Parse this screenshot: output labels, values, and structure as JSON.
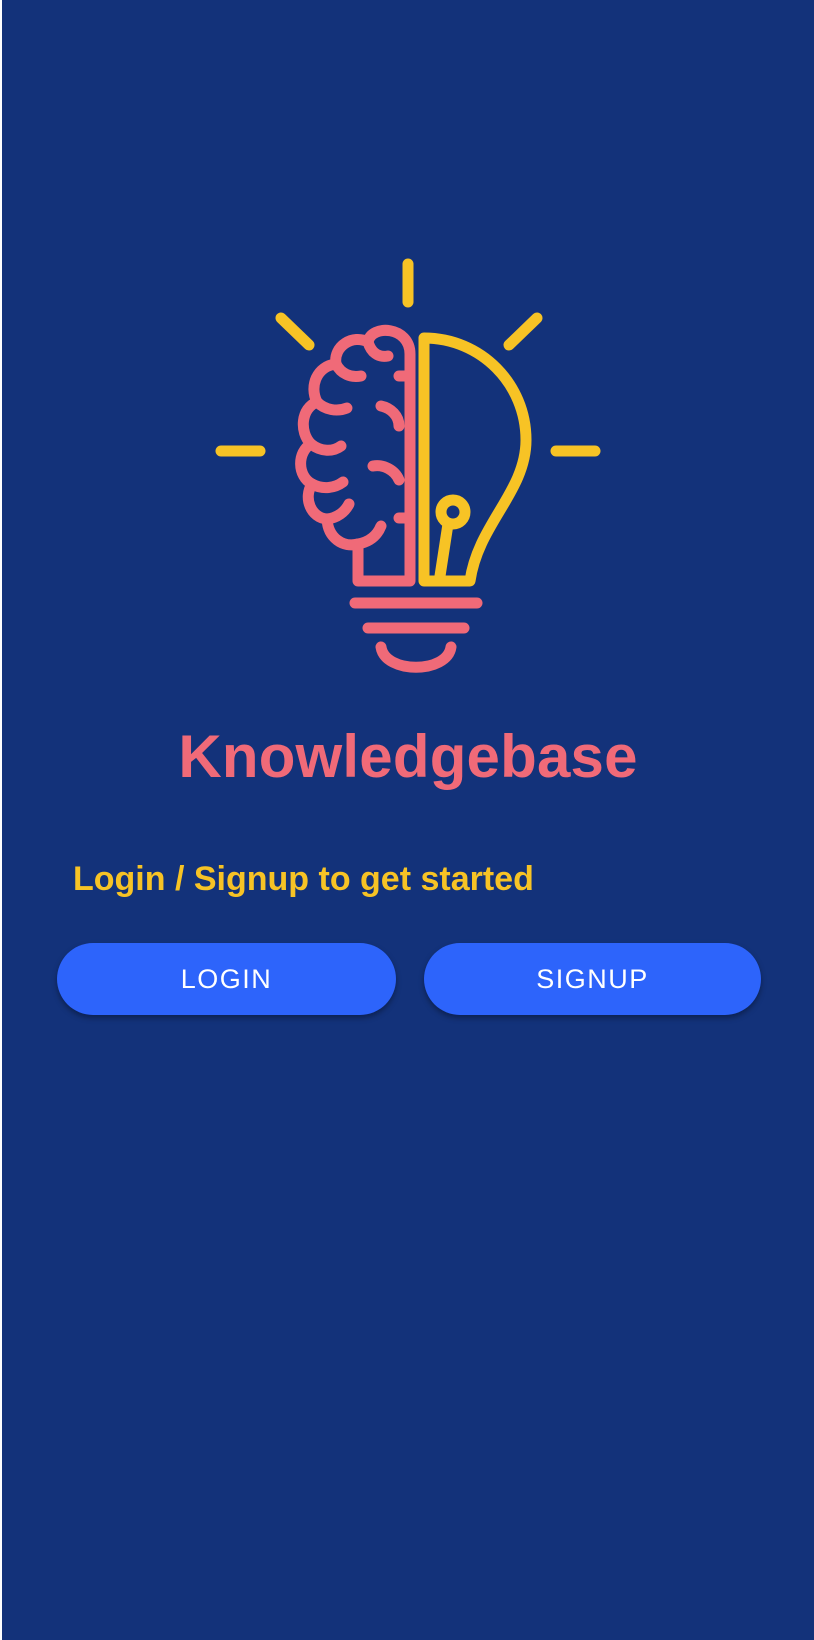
{
  "app": {
    "title": "Knowledgebase",
    "prompt": "Login / Signup to get started",
    "logo_icon": "brain-lightbulb-icon"
  },
  "buttons": {
    "login_label": "LOGIN",
    "signup_label": "SIGNUP"
  },
  "colors": {
    "background": "#13327a",
    "title": "#f06a78",
    "prompt": "#f7c325",
    "button": "#2d64fb",
    "button_text": "#ffffff",
    "logo_brain": "#f06a78",
    "logo_bulb": "#f7c325"
  }
}
